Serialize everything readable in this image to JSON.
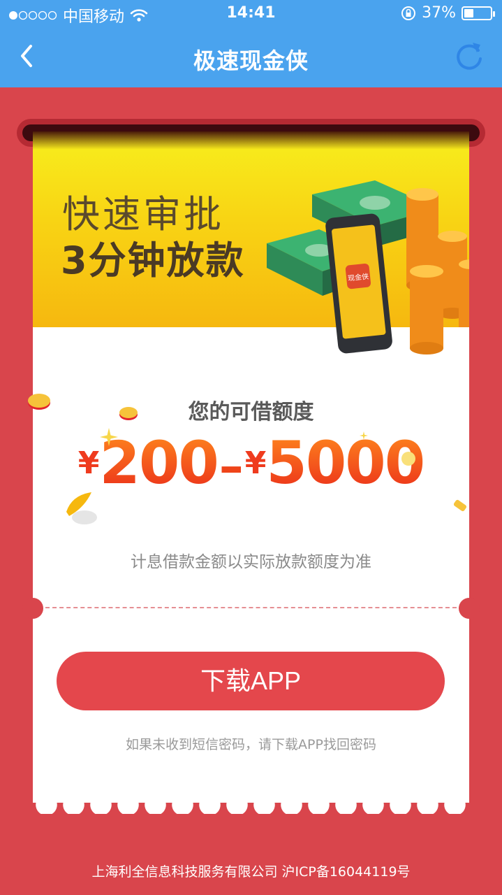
{
  "status_bar": {
    "carrier": "中国移动",
    "time": "14:41",
    "battery": "37%",
    "battery_level": 0.37
  },
  "nav": {
    "title": "极速现金侠",
    "back_icon": "chevron-left-icon",
    "refresh_icon": "refresh-icon"
  },
  "banner": {
    "line1": "快速审批",
    "line2": "3分钟放款",
    "app_badge": "现金侠"
  },
  "quota": {
    "label": "您的可借额度",
    "currency": "¥",
    "min": "200",
    "max": "5000",
    "note": "计息借款金额以实际放款额度为准"
  },
  "actions": {
    "download_label": "下载APP",
    "hint": "如果未收到短信密码，请下载APP找回密码"
  },
  "footer": {
    "company": "上海利全信息科技服务有限公司 沪ICP备16044119号"
  },
  "colors": {
    "nav_bg": "#4aa3ee",
    "page_bg": "#d9454c",
    "button_bg": "#e4474c",
    "amount": "#ef4419"
  }
}
